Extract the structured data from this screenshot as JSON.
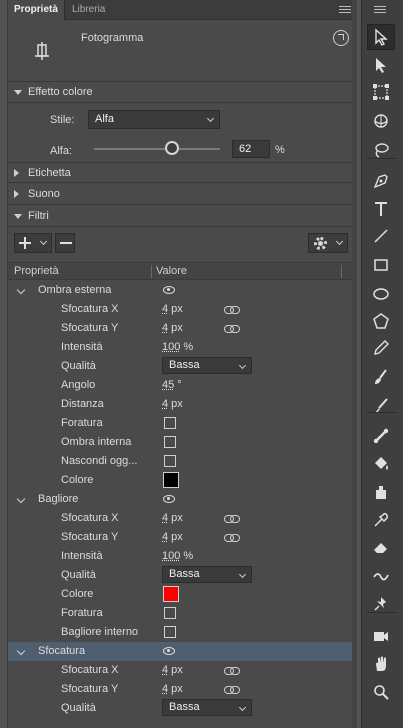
{
  "tabs": [
    {
      "label": "Proprietà",
      "active": true
    },
    {
      "label": "Libreria",
      "active": false
    }
  ],
  "frame": {
    "label": "Fotogramma"
  },
  "color_effect": {
    "title": "Effetto colore",
    "style_label": "Stile:",
    "style_value": "Alfa",
    "alpha_label": "Alfa:",
    "alpha_value": "62",
    "alpha_unit": "%",
    "alpha_fraction": 0.62
  },
  "sections": {
    "label": "Etichetta",
    "sound": "Suono",
    "filters": "Filtri"
  },
  "table": {
    "col_property": "Proprietà",
    "col_value": "Valore"
  },
  "filters": [
    {
      "name": "Ombra esterna",
      "rows": [
        {
          "label": "Sfocatura X",
          "num": "4",
          "unit": " px",
          "linked": true
        },
        {
          "label": "Sfocatura Y",
          "num": "4",
          "unit": " px",
          "linked": true
        },
        {
          "label": "Intensità",
          "num": "100",
          "unit": " %"
        },
        {
          "label": "Qualità",
          "select": "Bassa"
        },
        {
          "label": "Angolo",
          "num": "45",
          "unit": " °"
        },
        {
          "label": "Distanza",
          "num": "4",
          "unit": " px"
        },
        {
          "label": "Foratura",
          "checkbox": false
        },
        {
          "label": "Ombra interna",
          "checkbox": false
        },
        {
          "label": "Nascondi ogg...",
          "checkbox": false
        },
        {
          "label": "Colore",
          "color": "#000000"
        }
      ]
    },
    {
      "name": "Bagliore",
      "rows": [
        {
          "label": "Sfocatura X",
          "num": "4",
          "unit": " px",
          "linked": true
        },
        {
          "label": "Sfocatura Y",
          "num": "4",
          "unit": " px",
          "linked": true
        },
        {
          "label": "Intensità",
          "num": "100",
          "unit": " %"
        },
        {
          "label": "Qualità",
          "select": "Bassa"
        },
        {
          "label": "Colore",
          "color": "#ff0000"
        },
        {
          "label": "Foratura",
          "checkbox": false
        },
        {
          "label": "Bagliore interno",
          "checkbox": false
        }
      ]
    },
    {
      "name": "Sfocatura",
      "selected": true,
      "rows": [
        {
          "label": "Sfocatura X",
          "num": "4",
          "unit": " px",
          "linked": true
        },
        {
          "label": "Sfocatura Y",
          "num": "4",
          "unit": " px",
          "linked": true
        },
        {
          "label": "Qualità",
          "select": "Bassa"
        }
      ]
    }
  ],
  "colors": {
    "selection": "#4f5f70",
    "accent_red": "#ff0000"
  },
  "tools": [
    "selection-icon",
    "subselection-icon",
    "free-transform-icon",
    "3d-rotation-icon",
    "lasso-icon",
    "pen-icon",
    "text-icon",
    "line-icon",
    "rectangle-icon",
    "oval-icon",
    "polygon-icon",
    "pencil-icon",
    "paint-brush-icon",
    "brush-icon",
    "bone-icon",
    "paint-bucket-icon",
    "ink-bottle-icon",
    "eyedropper-icon",
    "eraser-icon",
    "width-icon",
    "pin-icon",
    "camera-icon",
    "hand-icon",
    "zoom-icon"
  ]
}
